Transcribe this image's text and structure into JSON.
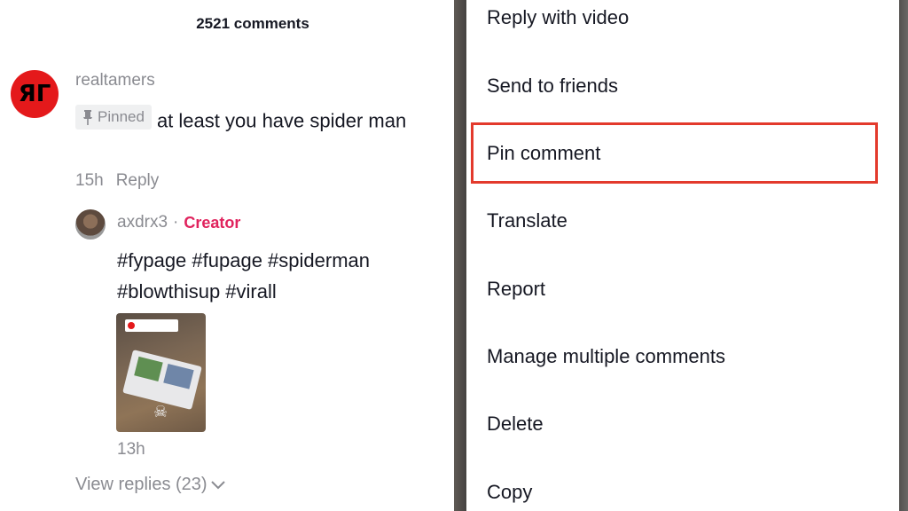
{
  "comments_header": "2521 comments",
  "comment": {
    "avatar_glyph": "ЯГ",
    "username": "realtamers",
    "pinned_label": "Pinned",
    "text": "at least you have spider man",
    "time": "15h",
    "reply_label": "Reply"
  },
  "reply": {
    "username": "axdrx3",
    "separator": "·",
    "creator_label": "Creator",
    "text": " #fypage #fupage #spiderman #blowthisup #virall",
    "time": "13h"
  },
  "view_replies": "View replies (23)",
  "menu": {
    "items": [
      "Reply with video",
      "Send to friends",
      "Pin comment",
      "Translate",
      "Report",
      "Manage multiple comments",
      "Delete",
      "Copy"
    ],
    "highlighted": "Pin comment"
  },
  "colors": {
    "highlight_border": "#e33a2c",
    "creator": "#e0245e",
    "avatar_bg": "#e4191b"
  },
  "icons": [
    "pin-icon",
    "chevron-down-icon"
  ]
}
